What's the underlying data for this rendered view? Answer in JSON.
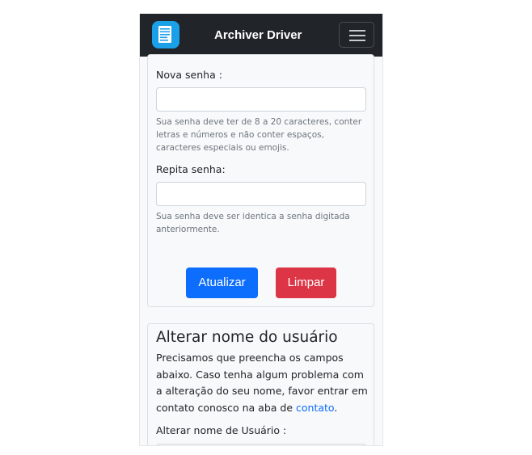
{
  "navbar": {
    "brand": "Archiver Driver",
    "logo_icon": "document-icon",
    "menu_icon": "hamburger-menu-icon"
  },
  "password_form": {
    "new_password_label": "Nova senha :",
    "new_password_value": "",
    "new_password_help": "Sua senha deve ter de 8 a 20 caracteres, conter letras e números e não conter espaços, caracteres especiais ou emojis.",
    "repeat_password_label": "Repita senha:",
    "repeat_password_value": "",
    "repeat_password_help": "Sua senha deve ser identica a senha digitada anteriormente.",
    "update_button": "Atualizar",
    "clear_button": "Limpar"
  },
  "username_form": {
    "title": "Alterar nome do usuário",
    "description": "Precisamos que preencha os campos abaixo. Caso tenha algum problema com a alteração do seu nome, favor entrar em contato conosco na aba de",
    "contact_link": "contato",
    "description_end": ".",
    "username_label": "Alterar nome de Usuário :"
  },
  "colors": {
    "navbar_bg": "#212529",
    "primary": "#0d6efd",
    "danger": "#dc3545",
    "link": "#0d6efd"
  }
}
